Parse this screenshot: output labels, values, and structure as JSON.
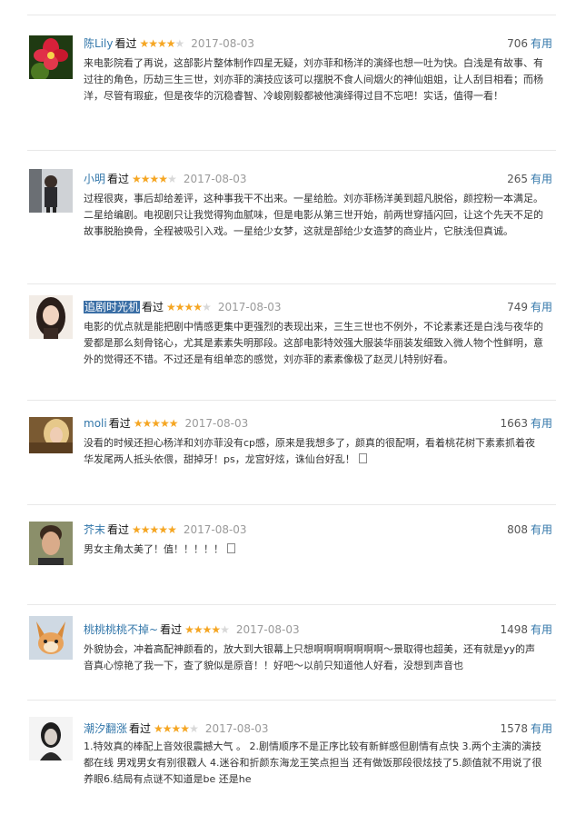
{
  "action_label": "看过",
  "useful_label": "有用",
  "reviews": [
    {
      "author": "陈Lily",
      "date": "2017-08-03",
      "rating": 4,
      "useful_count": "706",
      "content": "来电影院看了再说，这部影片整体制作四星无疑，刘亦菲和杨洋的演绎也想一吐为快。白浅是有故事、有过往的角色，历劫三生三世，刘亦菲的演技应该可以摆脱不食人间烟火的神仙姐姐，让人刮目相看；而杨洋，尽管有瑕疵，但是夜华的沉稳睿智、冷峻刚毅都被他演绎得过目不忘吧！实话，值得一看！"
    },
    {
      "author": "小明",
      "date": "2017-08-03",
      "rating": 4,
      "useful_count": "265",
      "content": "过程很爽，事后却给差评，这种事我干不出来。一星给脸。刘亦菲杨洋美到超凡脱俗，颜控粉一本满足。二星给编剧。电视剧只让我觉得狗血腻味，但是电影从第三世开始，前两世穿插闪回，让这个先天不足的故事脱胎换骨，全程被吸引入戏。一星给少女梦，这就是部给少女造梦的商业片，它肤浅但真诚。"
    },
    {
      "author": "追剧时光机",
      "date": "2017-08-03",
      "rating": 4,
      "useful_count": "749",
      "content": "电影的优点就是能把剧中情感更集中更强烈的表现出来，三生三世也不例外，不论素素还是白浅与夜华的爱都是那么刻骨铭心，尤其是素素失明那段。这部电影特效强大服装华丽装发细致入微人物个性鲜明，意外的觉得还不错。不过还是有组单恋的感觉，刘亦菲的素素像极了赵灵儿特别好看。"
    },
    {
      "author": "moli",
      "date": "2017-08-03",
      "rating": 5,
      "useful_count": "1663",
      "content": "没看的时候还担心杨洋和刘亦菲没有cp感，原来是我想多了，颜真的很配啊，看着桃花树下素素抓着夜华发尾两人抵头依偎，甜掉牙！ps，龙宫好炫，诛仙台好乱！"
    },
    {
      "author": "芥末",
      "date": "2017-08-03",
      "rating": 5,
      "useful_count": "808",
      "content": "男女主角太美了！值！！！！！"
    },
    {
      "author": "桃桃桃桃不掉~",
      "date": "2017-08-03",
      "rating": 4,
      "useful_count": "1498",
      "content": "外貌协会，冲着高配神颜看的，放大到大银幕上只想啊啊啊啊啊啊啊～景取得也超美，还有就是yy的声音真心惊艳了我一下，查了貌似是原音！！好吧～以前只知道他人好看，没想到声音也"
    },
    {
      "author": "潮汐翻涨",
      "date": "2017-08-03",
      "rating": 4,
      "useful_count": "1578",
      "content": "1.特效真的棒配上音效很震撼大气 。 2.剧情顺序不是正序比较有新鲜感但剧情有点快 3.两个主演的演技都在线 男戏男女有别很戳人 4.迷谷和折颜东海龙王笑点担当 还有做饭那段很炫技了5.颜值就不用说了很养眼6.结局有点谜不知道是be 还是he"
    }
  ]
}
